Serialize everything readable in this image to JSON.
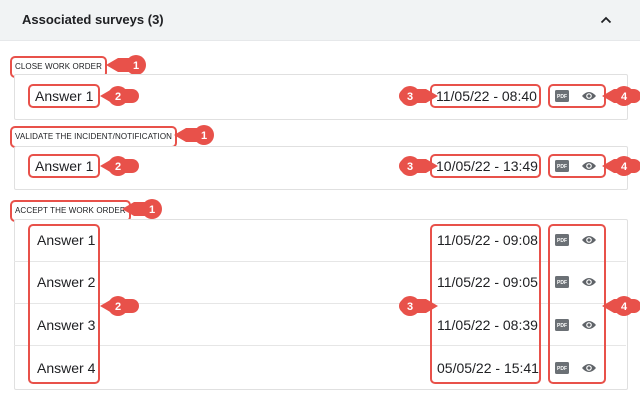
{
  "header": {
    "title": "Associated surveys (3)",
    "collapse_icon": "chevron-up-icon"
  },
  "sections": [
    {
      "label": "CLOSE WORK ORDER",
      "rows": [
        {
          "answer": "Answer 1",
          "date": "11/05/22 - 08:40"
        }
      ]
    },
    {
      "label": "VALIDATE THE INCIDENT/NOTIFICATION",
      "rows": [
        {
          "answer": "Answer 1",
          "date": "10/05/22 - 13:49"
        }
      ]
    },
    {
      "label": "ACCEPT THE WORK ORDER",
      "rows": [
        {
          "answer": "Answer 1",
          "date": "11/05/22 - 09:08"
        },
        {
          "answer": "Answer 2",
          "date": "11/05/22 - 09:05"
        },
        {
          "answer": "Answer 3",
          "date": "11/05/22 - 08:39"
        },
        {
          "answer": "Answer 4",
          "date": "05/05/22 - 15:41"
        }
      ]
    }
  ],
  "callouts": {
    "section": "1",
    "answer": "2",
    "date": "3",
    "actions": "4"
  },
  "icons": {
    "pdf": "pdf-icon",
    "view": "eye-icon"
  },
  "colors": {
    "callout": "#e8514a",
    "header_bg": "#f1f3f4",
    "icon": "#5f6368"
  },
  "pdf_icon_text": "PDF"
}
